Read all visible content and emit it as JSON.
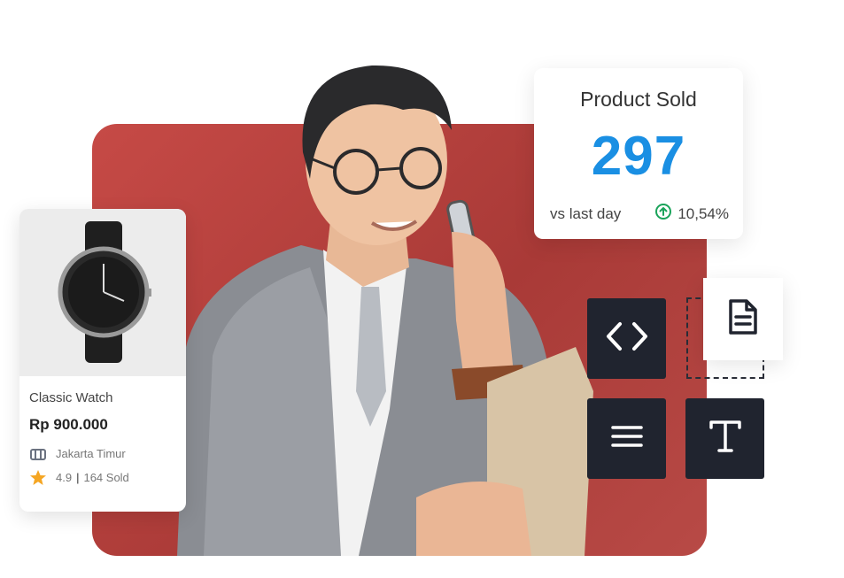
{
  "product_card": {
    "title": "Classic Watch",
    "price": "Rp 900.000",
    "location": "Jakarta Timur",
    "rating": "4.9",
    "sold": "164 Sold",
    "icons": {
      "location": "store-icon",
      "rating": "star-icon"
    },
    "colors": {
      "star": "#f5a623"
    }
  },
  "stats_card": {
    "title": "Product Sold",
    "value": "297",
    "compare_label": "vs last day",
    "change": "10,54%",
    "colors": {
      "value": "#1a8fe3",
      "change_icon": "#1aa35a"
    }
  },
  "tools": [
    {
      "icon": "code-icon"
    },
    {
      "icon": "document-icon"
    },
    {
      "icon": "menu-icon"
    },
    {
      "icon": "text-icon"
    }
  ],
  "colors": {
    "panel": "#b8423f",
    "tile": "#20242f"
  }
}
